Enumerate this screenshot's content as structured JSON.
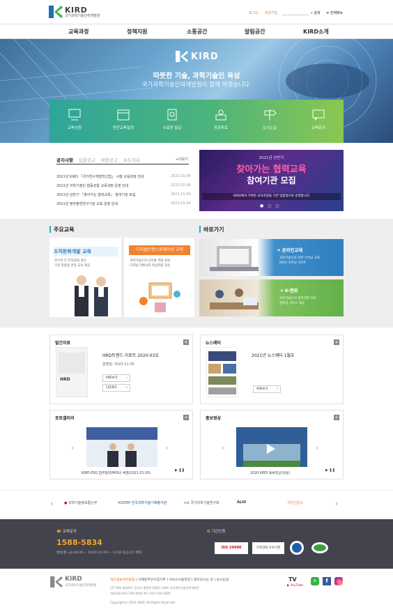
{
  "header": {
    "logo_text": "KIRD",
    "logo_sub": "국가과학기술인력개발원",
    "links": [
      "로그인",
      "회원가입"
    ],
    "search_label": "검색",
    "sitemap_label": "전체메뉴"
  },
  "nav": [
    "교육과정",
    "정책지원",
    "소통공간",
    "알림공간",
    "KIRD소개"
  ],
  "hero": {
    "brand": "KIRD",
    "line1": "따뜻한 기술, 과학기술인 육성",
    "line2": "국가과학기술인력개발원이 함께 하겠습니다."
  },
  "quick_menu": [
    "교육신청",
    "연간교육일정",
    "수료증 발급",
    "성과자료",
    "오시는길",
    "교육문의"
  ],
  "notice": {
    "tabs": [
      "공지사항",
      "입찰공고",
      "채용공고",
      "보도자료"
    ],
    "more": "+더보기",
    "items": [
      {
        "title": "2021년 KIRD 「국가연구개발혁신법」 시행 교육과정 안내",
        "date": "2021.01.08"
      },
      {
        "title": "2021년 과학기술인 협동조합 교육과정 운영 안내",
        "date": "2021.01.06"
      },
      {
        "title": "2021년 상반기 「찾아가는 협력교육」 참여기관 모집",
        "date": "2021.01.04"
      },
      {
        "title": "2021년 정부출연연구기관 교육 일정 안내",
        "date": "2021.01.04"
      }
    ]
  },
  "banner": {
    "kicker": "2021년 상반기",
    "title1": "찾아가는 협력교육",
    "title2": "참여기관 모집",
    "desc": "KIRD에서 기획한 교육과정을 기관 맞춤형으로 운영합니다"
  },
  "main_edu": {
    "title": "주요교육",
    "cards": [
      {
        "title": "조직문화개발 교육",
        "desc1": "연구자 간 조직문화 개선",
        "desc2": "기관 맞춤형 현장 교육 제공"
      },
      {
        "title": "디지털트랜스포메이션 교육",
        "desc1": "과학기술인의 디지털 역량 강화",
        "desc2": "디지털 전환시대 핵심역량 교육"
      }
    ]
  },
  "shortcuts": {
    "title": "바로가기",
    "items": [
      {
        "title": "온라인교육",
        "desc1": "과학기술인을 위한 이러닝 교육",
        "desc2": "KIRD 이러닝 사이트"
      },
      {
        "title": "K-멘토",
        "desc1": "과학기술인의 경력개발 지원",
        "desc2": "멘토링 서비스 제공"
      }
    ]
  },
  "publications": {
    "title": "발간자료",
    "item_title": "HRD트렌드 리포트 2020-03호",
    "date_label": "발행일: 2020.11.30",
    "btn_read": "바로보기",
    "btn_download": "다운로드"
  },
  "newsletter": {
    "title": "뉴스레터",
    "item_title": "2021년 뉴스레터 1월호",
    "btn": "바로보기"
  },
  "photo_news": {
    "title": "포토갤러리",
    "caption": "KIRD-ESG 업무협약(MOU) 체결(2021.01.05)"
  },
  "video": {
    "title": "홍보영상",
    "caption": "2020 KIRD 홍보영상(국문)"
  },
  "partners": [
    "과학기술정보통신부",
    "KISTEP 한국과학기술기획평가원",
    "nst 국가과학기술연구회",
    "ALIO",
    "국민신문고"
  ],
  "contact": {
    "label": "교육문의",
    "phone": "1588-5834",
    "hours": "평일(월~금) 09:00 ~ 18:00 (12:00 ~ 13:00 점심시간 제외)",
    "cert_label": "기관인증",
    "cert1": "ISO 29990",
    "cert2": "가족친화 우수기관"
  },
  "footer": {
    "logo_text": "KIRD",
    "logo_sub": "국가과학기술인력개발원",
    "links": [
      "개인정보처리방침",
      "이메일무단수집거부",
      "서비스이용약관",
      "찾아오시는 길",
      "오시는길"
    ],
    "address": "(27740) 충청북도 음성군 맹동면 원중로 1390 국가과학기술인력개발원",
    "tel": "대표전화 043-750-3000  팩스 043-750-3099",
    "copyright": "Copyright(c) 2021 KIRD. All Rights Reserved."
  }
}
